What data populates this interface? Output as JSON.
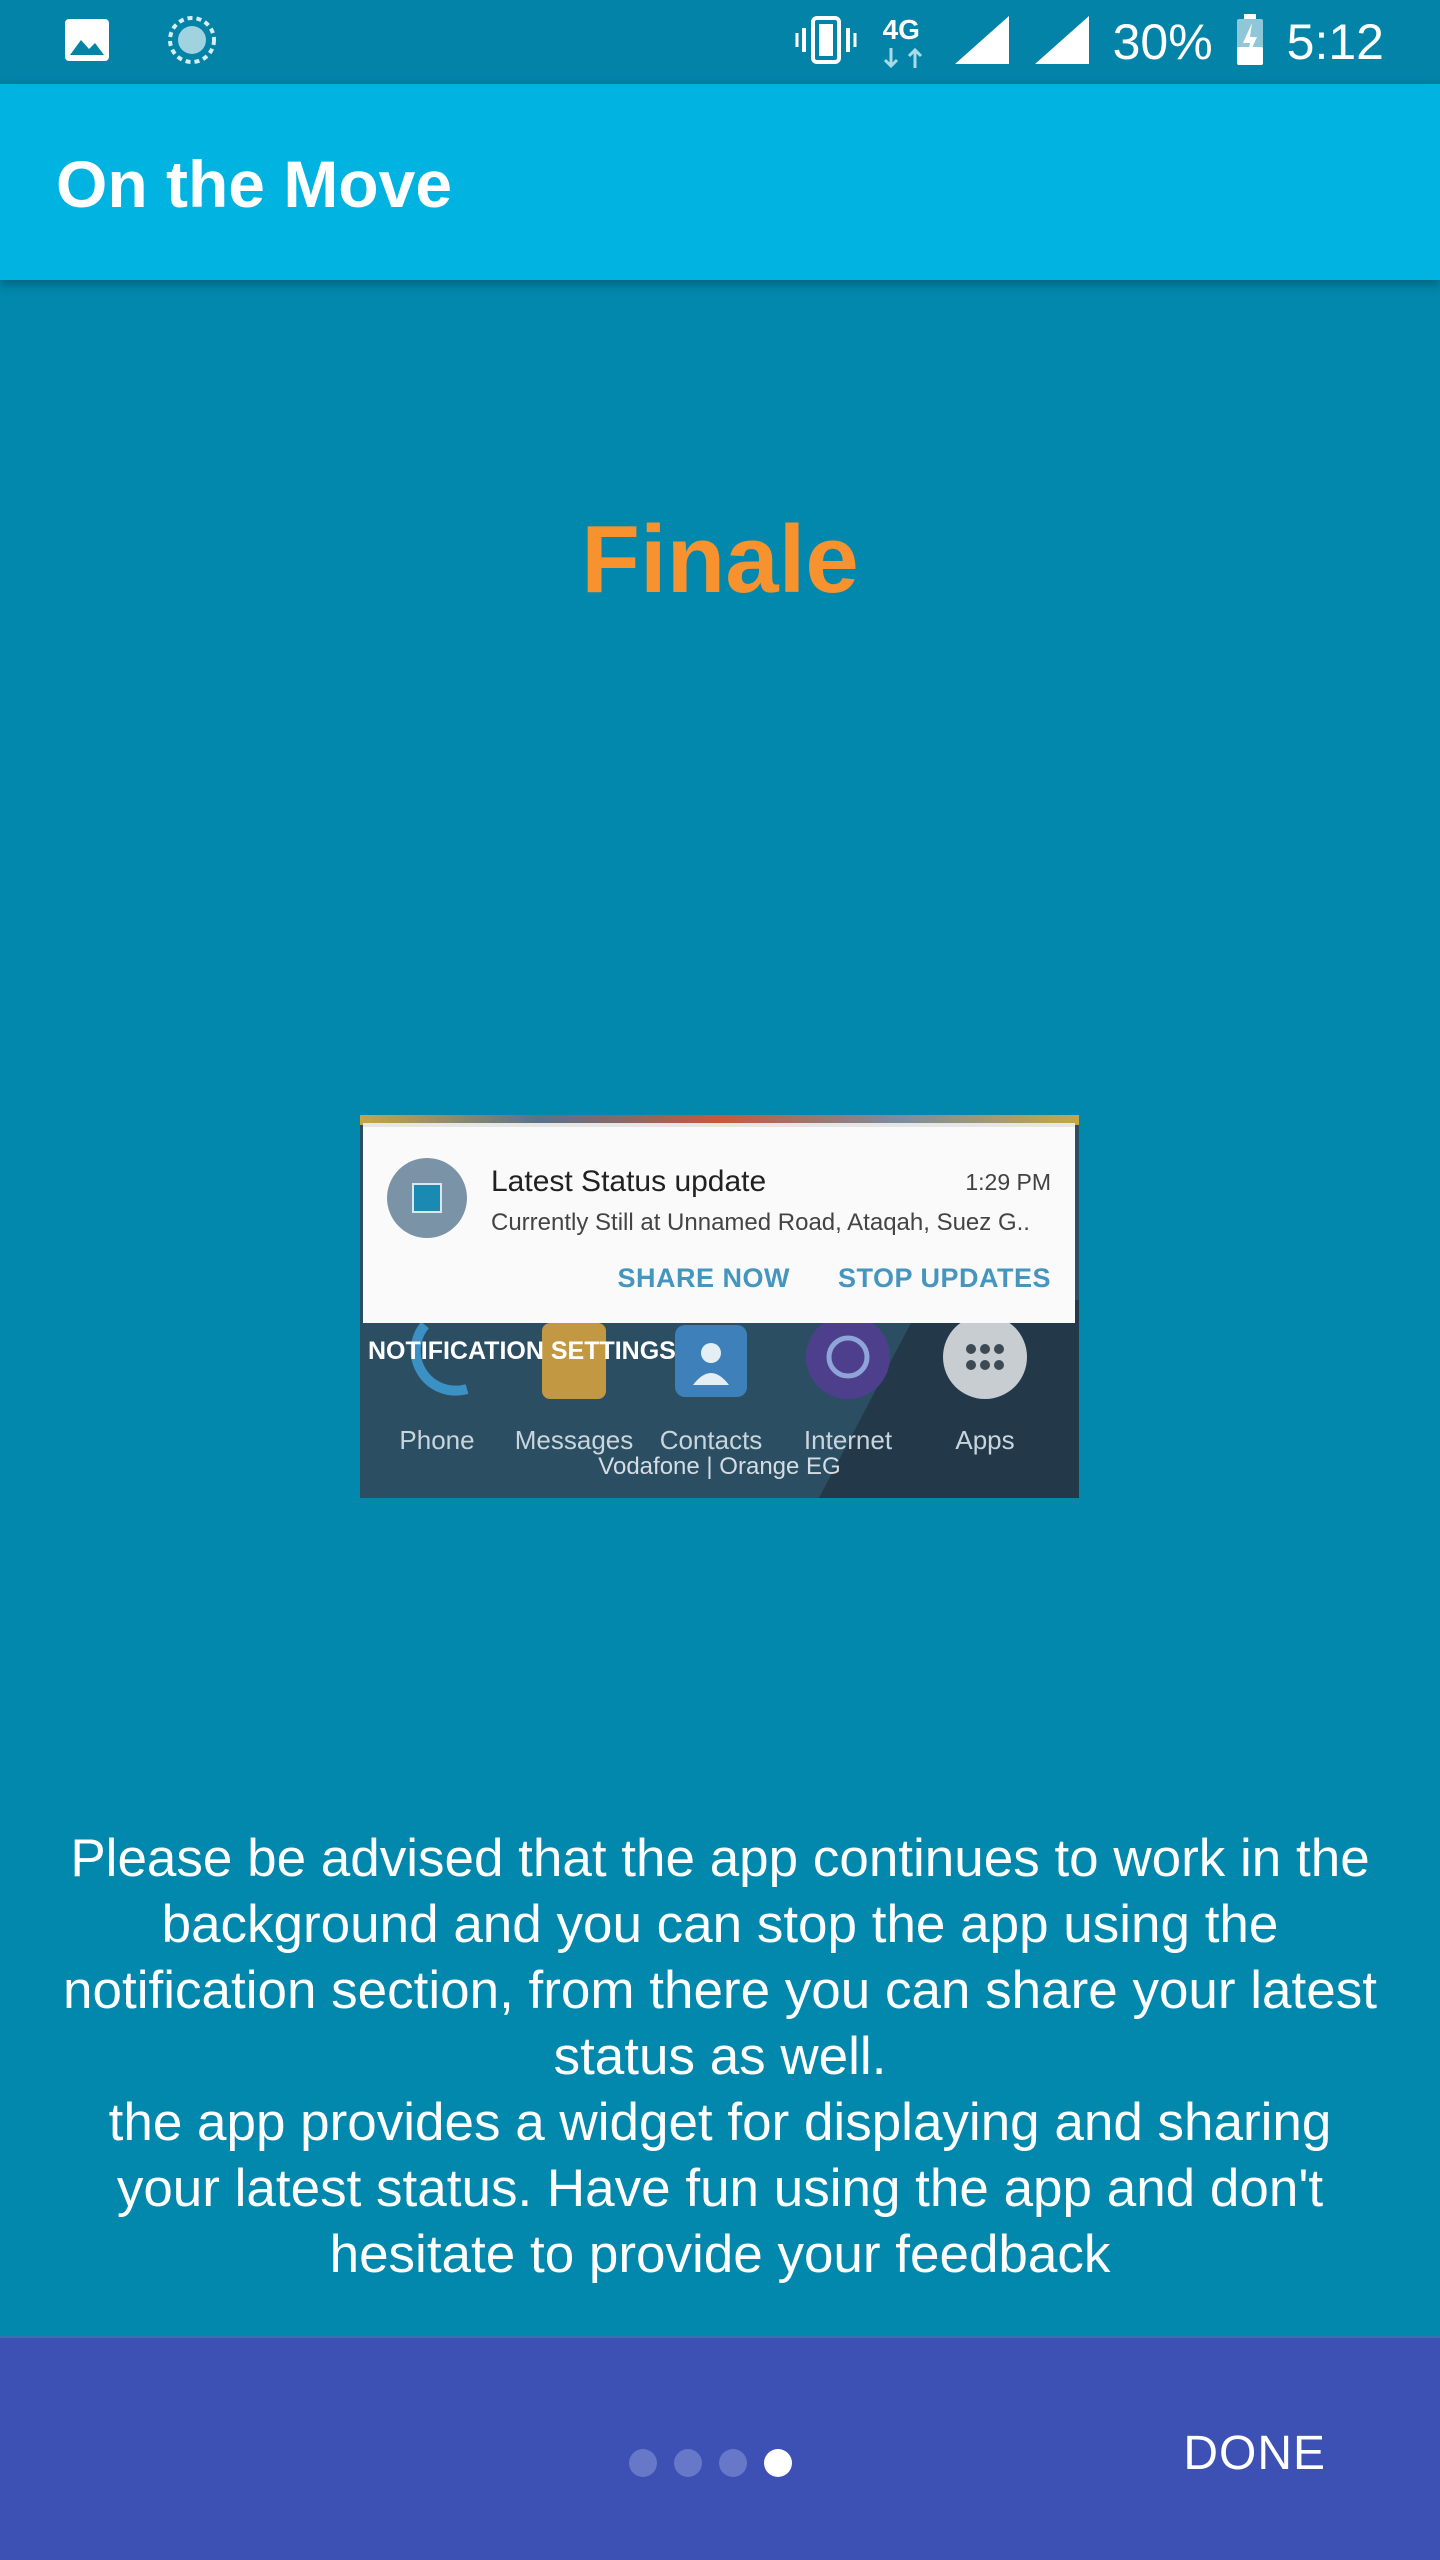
{
  "status_bar": {
    "network": "4G",
    "battery": "30%",
    "time": "5:12",
    "icons": [
      "image-icon",
      "loading-icon",
      "vibrate-icon",
      "network-4g-icon",
      "signal-icon",
      "signal-icon-2",
      "battery-charging-icon"
    ]
  },
  "app_bar": {
    "title": "On the Move"
  },
  "slide": {
    "title": "Finale",
    "title_color": "#f7922e"
  },
  "preview": {
    "notification": {
      "title": "Latest Status update",
      "time": "1:29 PM",
      "body": "Currently Still at Unnamed Road, Ataqah, Suez G..",
      "actions": [
        "SHARE NOW",
        "STOP UPDATES"
      ]
    },
    "notification_settings": "NOTIFICATION SETTINGS",
    "dock": [
      {
        "label": "Phone",
        "icon": "phone-icon"
      },
      {
        "label": "Messages",
        "icon": "messages-icon"
      },
      {
        "label": "Contacts",
        "icon": "contacts-icon"
      },
      {
        "label": "Internet",
        "icon": "internet-icon"
      },
      {
        "label": "Apps",
        "icon": "apps-icon"
      }
    ],
    "carrier": "Vodafone | Orange EG"
  },
  "description": {
    "paragraph_1": "Please be advised that the app continues to work in the background and you can stop the app using the notification section, from there you can share your latest status as well.",
    "paragraph_2": "the app provides a widget for displaying and sharing your latest status. Have fun using the app and don't hesitate to provide your feedback"
  },
  "bottom_bar": {
    "page_count": 4,
    "current_page": 4,
    "done_label": "DONE"
  },
  "colors": {
    "background": "#0287ad",
    "app_bar": "#00b3e0",
    "bottom_bar": "#3d51b4"
  }
}
